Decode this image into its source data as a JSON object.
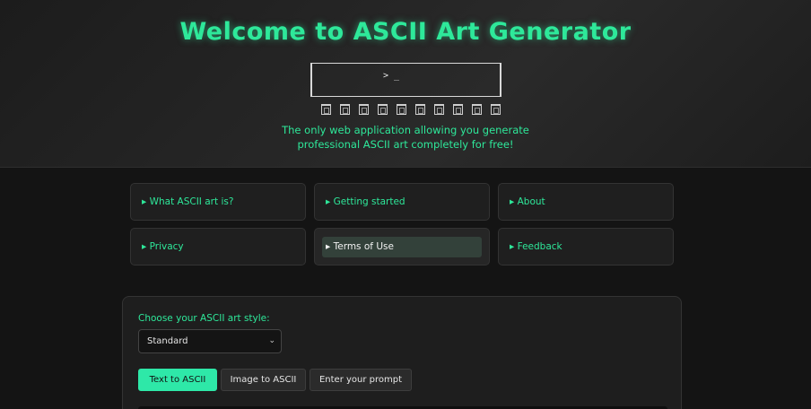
{
  "header": {
    "title": "Welcome to ASCII Art Generator",
    "terminal_prompt": "> _",
    "subtitle_line1": "The only web application allowing you generate",
    "subtitle_line2": "professional ASCII art completely for free!"
  },
  "nav": {
    "items": [
      {
        "label": "▸ What ASCII art is?"
      },
      {
        "label": "▸ Getting started"
      },
      {
        "label": "▸ About"
      },
      {
        "label": "▸ Privacy"
      },
      {
        "label": "▸ Terms of Use"
      },
      {
        "label": "▸ Feedback"
      }
    ]
  },
  "generator": {
    "style_label": "Choose your ASCII art style:",
    "style_value": "Standard",
    "tabs": [
      {
        "label": "Text to ASCII"
      },
      {
        "label": "Image to ASCII"
      },
      {
        "label": "Enter your prompt"
      }
    ]
  },
  "colors": {
    "accent": "#2ee89a",
    "active_tab": "#2ee8a8",
    "background": "#141414"
  }
}
